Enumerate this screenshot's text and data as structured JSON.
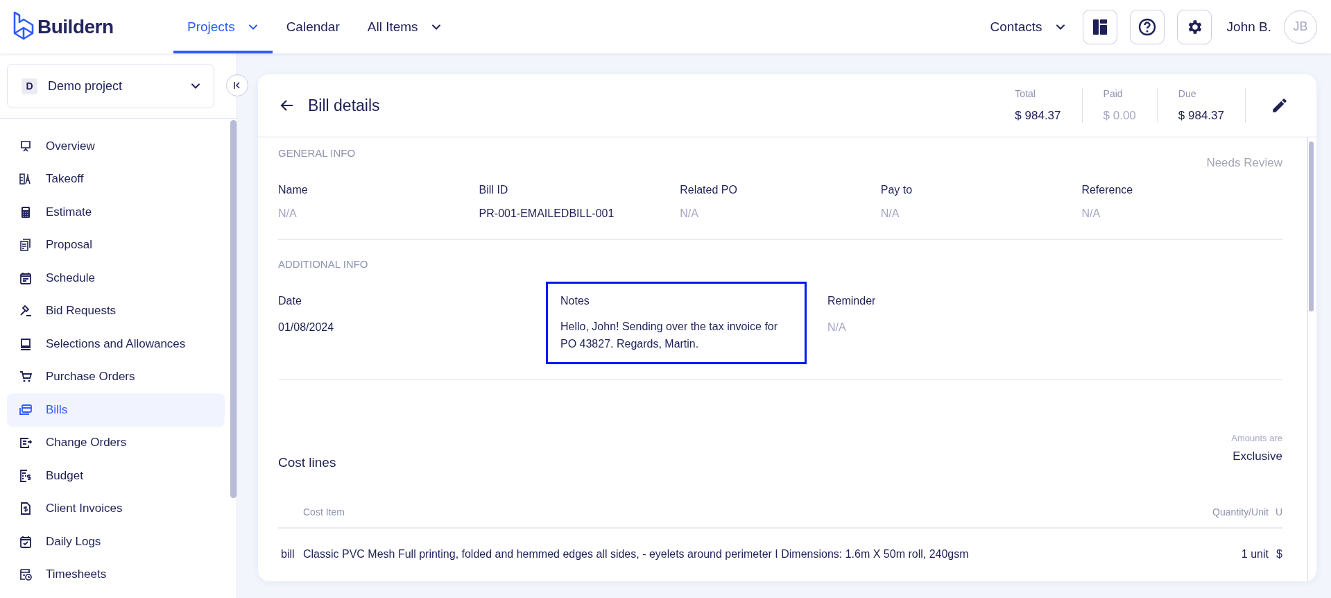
{
  "brand": {
    "name": "Buildern"
  },
  "nav": [
    {
      "label": "Projects",
      "selected": true,
      "dropdown": true
    },
    {
      "label": "Calendar",
      "selected": false,
      "dropdown": false
    },
    {
      "label": "All Items",
      "selected": false,
      "dropdown": true
    }
  ],
  "header_right": {
    "contacts": {
      "label": "Contacts",
      "dropdown": true
    },
    "user": {
      "name": "John B.",
      "initials": "JB"
    }
  },
  "sidebar": {
    "project": {
      "badge": "D",
      "name": "Demo project"
    },
    "items": [
      {
        "label": "Overview",
        "selected": false
      },
      {
        "label": "Takeoff",
        "selected": false
      },
      {
        "label": "Estimate",
        "selected": false
      },
      {
        "label": "Proposal",
        "selected": false
      },
      {
        "label": "Schedule",
        "selected": false
      },
      {
        "label": "Bid Requests",
        "selected": false
      },
      {
        "label": "Selections and Allowances",
        "selected": false
      },
      {
        "label": "Purchase Orders",
        "selected": false
      },
      {
        "label": "Bills",
        "selected": true
      },
      {
        "label": "Change Orders",
        "selected": false
      },
      {
        "label": "Budget",
        "selected": false
      },
      {
        "label": "Client Invoices",
        "selected": false
      },
      {
        "label": "Daily Logs",
        "selected": false
      },
      {
        "label": "Timesheets",
        "selected": false
      }
    ]
  },
  "bill": {
    "title": "Bill details",
    "amounts": [
      {
        "label": "Total",
        "value": "$ 984.37",
        "muted": false
      },
      {
        "label": "Paid",
        "value": "$ 0.00",
        "muted": true
      },
      {
        "label": "Due",
        "value": "$ 984.37",
        "muted": false
      }
    ],
    "general_info": {
      "heading": "GENERAL INFO",
      "status": "Needs Review",
      "fields": [
        {
          "label": "Name",
          "value": "N/A",
          "muted": true
        },
        {
          "label": "Bill ID",
          "value": "PR-001-EMAILEDBILL-001",
          "muted": false
        },
        {
          "label": "Related PO",
          "value": "N/A",
          "muted": true
        },
        {
          "label": "Pay to",
          "value": "N/A",
          "muted": true
        },
        {
          "label": "Reference",
          "value": "N/A",
          "muted": true
        }
      ]
    },
    "additional_info": {
      "heading": "ADDITIONAL INFO",
      "fields": [
        {
          "label": "Date",
          "value": "01/08/2024",
          "muted": false,
          "highlighted": false
        },
        {
          "label": "Notes",
          "value": "Hello, John! Sending over the tax invoice for PO 43827. Regards, Martin.",
          "muted": false,
          "highlighted": true
        },
        {
          "label": "Reminder",
          "value": "N/A",
          "muted": true,
          "highlighted": false
        }
      ]
    },
    "cost_lines": {
      "title": "Cost lines",
      "amounts_note": "Amounts are",
      "amounts_mode": "Exclusive",
      "table": {
        "columns": [
          "",
          "Cost Item",
          "Quantity/Unit",
          "U"
        ],
        "rows": [
          {
            "cells": [
              "bill",
              "Classic PVC Mesh Full printing, folded and hemmed edges all sides, - eyelets around perimeter I Dimensions: 1.6m X 50m roll, 240gsm",
              "1 unit",
              "$"
            ]
          }
        ]
      }
    }
  }
}
